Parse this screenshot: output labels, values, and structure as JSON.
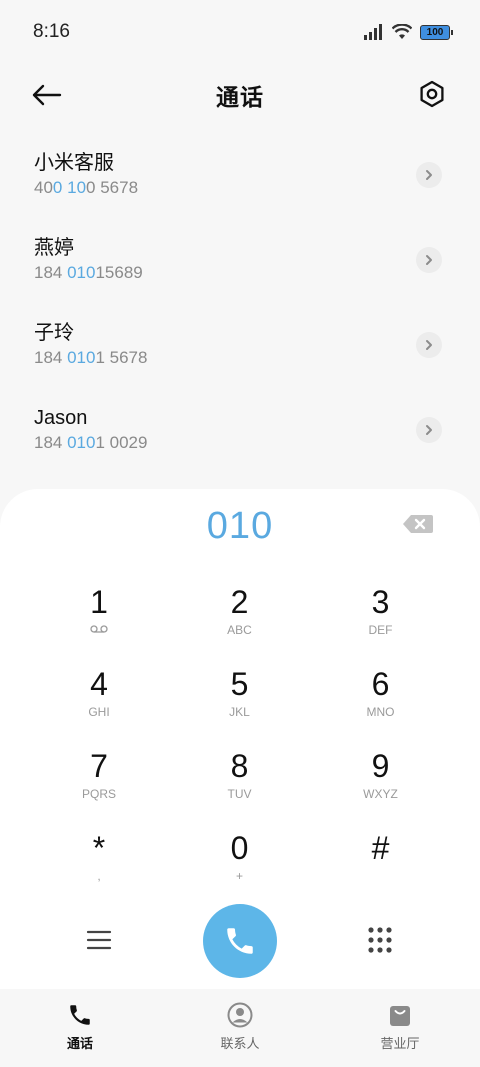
{
  "status_bar": {
    "time": "8:16",
    "battery": "100"
  },
  "header": {
    "title": "通话"
  },
  "contacts": [
    {
      "name": "小米客服",
      "number_parts": [
        "40",
        "0",
        " ",
        "10",
        "0 5678"
      ]
    },
    {
      "name": "燕婷",
      "number_parts": [
        "184 ",
        "010",
        "",
        "",
        "15689"
      ]
    },
    {
      "name": "子玲",
      "number_parts": [
        "184 ",
        "010",
        "",
        "",
        "1 5678"
      ]
    },
    {
      "name": "Jason",
      "number_parts": [
        "184 ",
        "010",
        "",
        "",
        "1 0029"
      ]
    }
  ],
  "dialpad": {
    "number": "010",
    "keys": [
      {
        "digit": "1",
        "sub": ""
      },
      {
        "digit": "2",
        "sub": "ABC"
      },
      {
        "digit": "3",
        "sub": "DEF"
      },
      {
        "digit": "4",
        "sub": "GHI"
      },
      {
        "digit": "5",
        "sub": "JKL"
      },
      {
        "digit": "6",
        "sub": "MNO"
      },
      {
        "digit": "7",
        "sub": "PQRS"
      },
      {
        "digit": "8",
        "sub": "TUV"
      },
      {
        "digit": "9",
        "sub": "WXYZ"
      },
      {
        "digit": "*",
        "sub": ","
      },
      {
        "digit": "0",
        "sub": "+"
      },
      {
        "digit": "#",
        "sub": ""
      }
    ]
  },
  "bottom_nav": [
    {
      "label": "通话",
      "icon": "phone-icon",
      "active": true
    },
    {
      "label": "联系人",
      "icon": "person-icon",
      "active": false
    },
    {
      "label": "营业厅",
      "icon": "shopping-bag-icon",
      "active": false
    }
  ],
  "colors": {
    "accent": "#5aa9e0",
    "call_button": "#5db6e8",
    "sheet": "#ffffff",
    "background": "#f7f7f7"
  }
}
